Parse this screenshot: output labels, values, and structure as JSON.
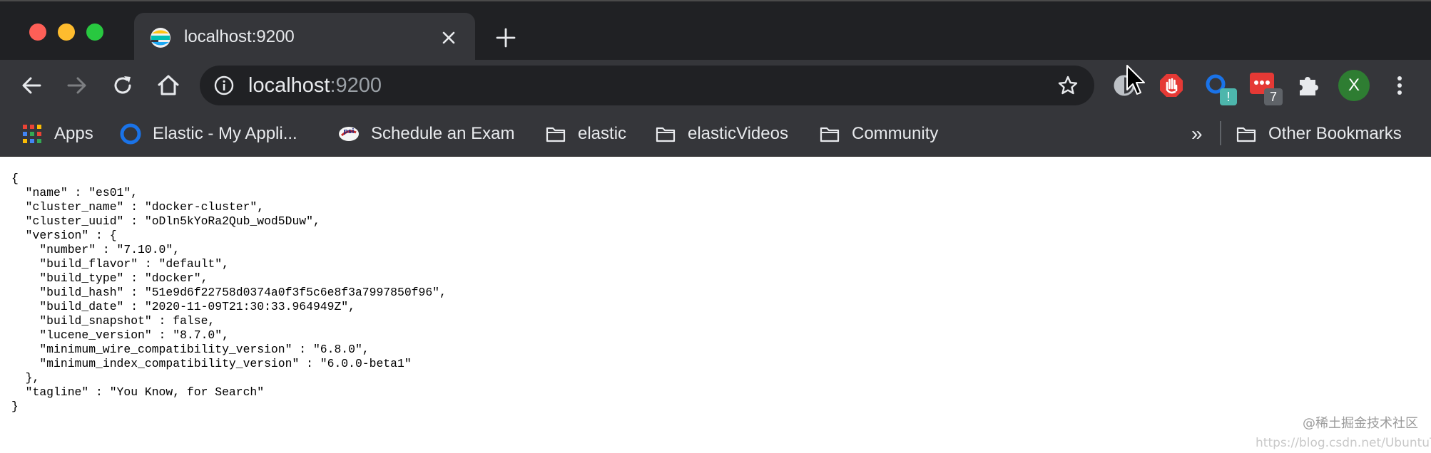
{
  "browser": {
    "tab": {
      "title": "localhost:9200"
    },
    "address_bar": {
      "host": "localhost",
      "port": ":9200"
    },
    "extensions": {
      "extension_badge_count": "7",
      "extension_badge_alert": "!",
      "profile_initial": "X"
    },
    "bookmarks": [
      {
        "label": "Apps",
        "icon": "apps-grid-icon"
      },
      {
        "label": "Elastic - My Appli...",
        "icon": "elastic-icon"
      },
      {
        "label": "Schedule an Exam",
        "icon": "psi-icon"
      },
      {
        "label": "elastic",
        "icon": "folder-icon"
      },
      {
        "label": "elasticVideos",
        "icon": "folder-icon"
      },
      {
        "label": "Community",
        "icon": "folder-icon"
      }
    ],
    "overflow_label": "»",
    "other_bookmarks": "Other Bookmarks"
  },
  "page": {
    "json_text": "{\n  \"name\" : \"es01\",\n  \"cluster_name\" : \"docker-cluster\",\n  \"cluster_uuid\" : \"oDln5kYoRa2Qub_wod5Duw\",\n  \"version\" : {\n    \"number\" : \"7.10.0\",\n    \"build_flavor\" : \"default\",\n    \"build_type\" : \"docker\",\n    \"build_hash\" : \"51e9d6f22758d0374a0f3f5c6e8f3a7997850f96\",\n    \"build_date\" : \"2020-11-09T21:30:33.964949Z\",\n    \"build_snapshot\" : false,\n    \"lucene_version\" : \"8.7.0\",\n    \"minimum_wire_compatibility_version\" : \"6.8.0\",\n    \"minimum_index_compatibility_version\" : \"6.0.0-beta1\"\n  },\n  \"tagline\" : \"You Know, for Search\"\n}",
    "watermark_primary": "@稀土掘金技术社区",
    "watermark_secondary": "https://blog.csdn.net/UbuntuTouch"
  },
  "colors": {
    "chrome_dark": "#202124",
    "chrome_toolbar": "#35363a",
    "text_light": "#e8eaed",
    "text_dim": "#9aa0a6"
  }
}
